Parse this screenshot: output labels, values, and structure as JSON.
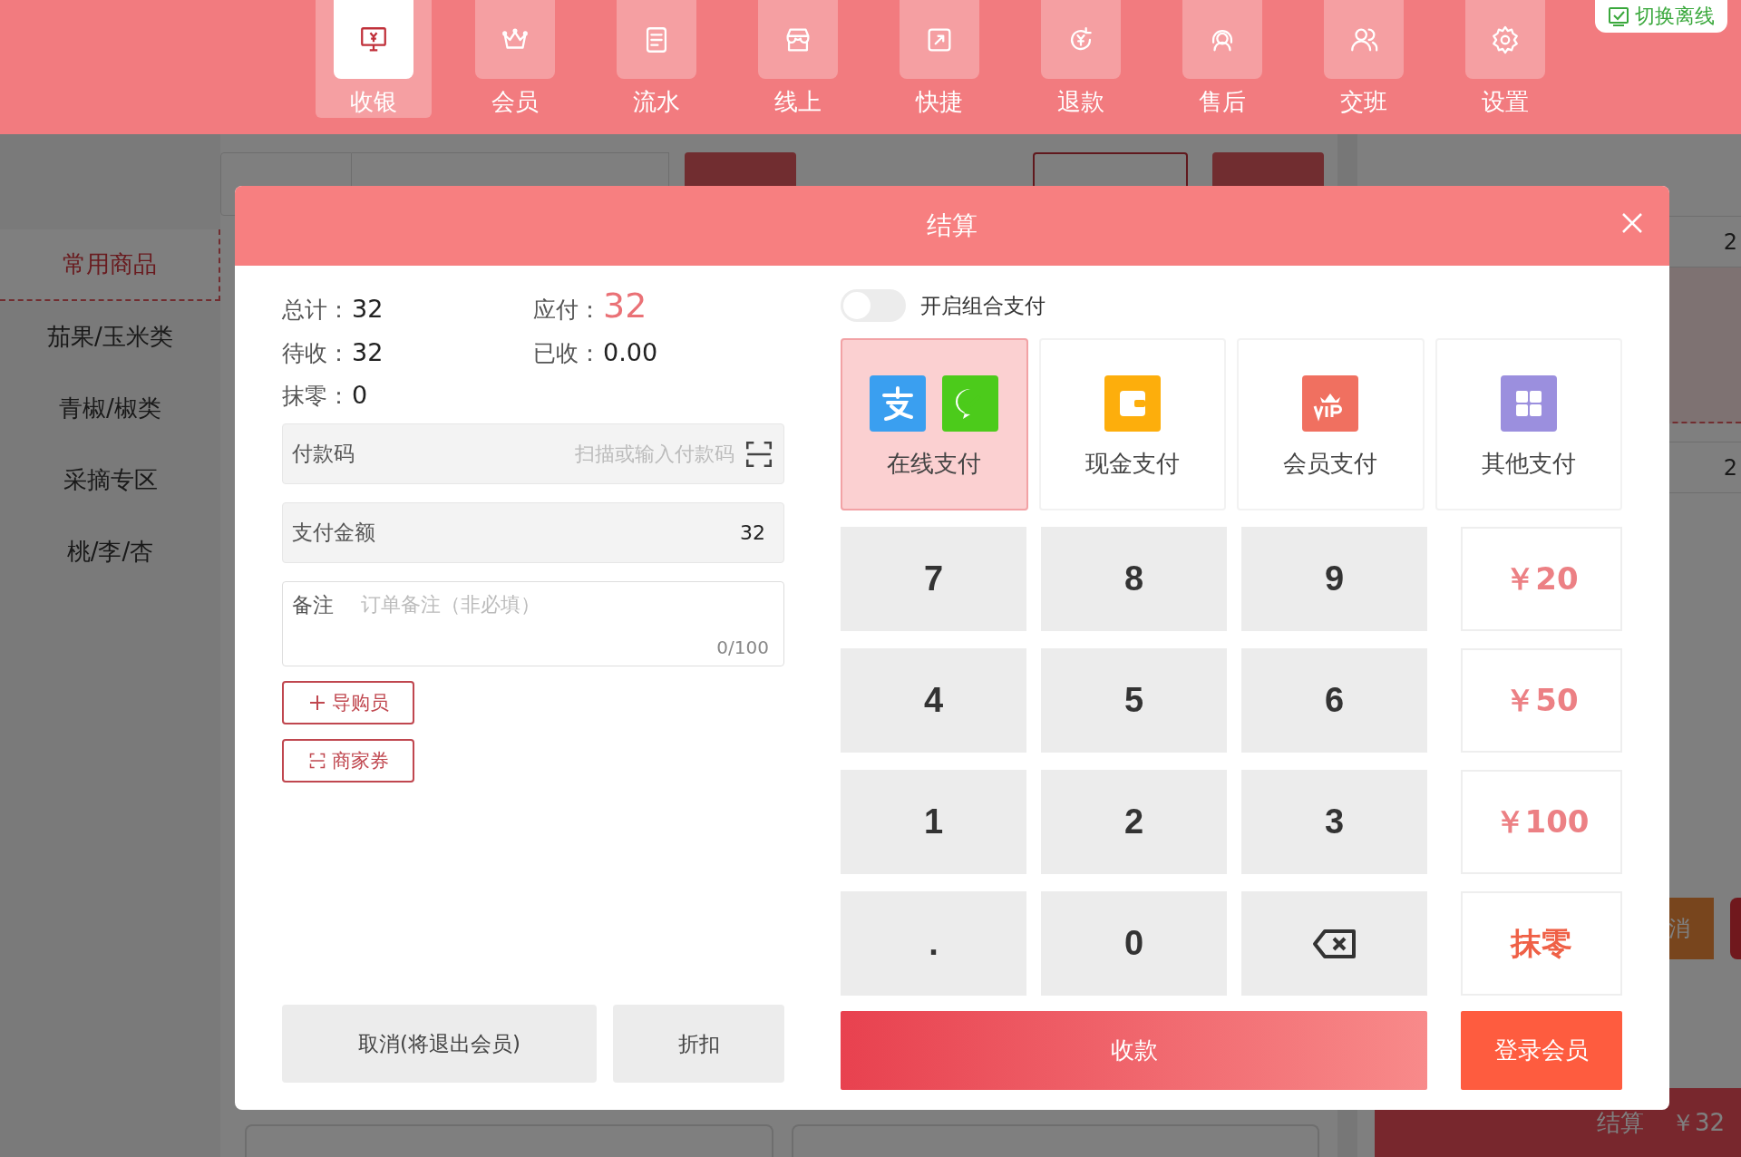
{
  "nav": {
    "items": [
      {
        "label": "收银",
        "kind": "register",
        "selected": true
      },
      {
        "label": "会员",
        "kind": "crown",
        "selected": false
      },
      {
        "label": "流水",
        "kind": "ledger",
        "selected": false
      },
      {
        "label": "线上",
        "kind": "store",
        "selected": false
      },
      {
        "label": "快捷",
        "kind": "shortcut",
        "selected": false
      },
      {
        "label": "退款",
        "kind": "refund",
        "selected": false
      },
      {
        "label": "售后",
        "kind": "service",
        "selected": false
      },
      {
        "label": "交班",
        "kind": "staff",
        "selected": false
      },
      {
        "label": "设置",
        "kind": "settings",
        "selected": false
      }
    ],
    "offline_button": "切换离线"
  },
  "sidebar": {
    "items": [
      {
        "label": "常用商品",
        "selected": true
      },
      {
        "label": "茄果/玉米类",
        "selected": false
      },
      {
        "label": "青椒/椒类",
        "selected": false
      },
      {
        "label": "采摘专区",
        "selected": false
      },
      {
        "label": "桃/李/杏",
        "selected": false
      }
    ]
  },
  "cart": {
    "rows": [
      {
        "value": "2"
      },
      {
        "value": "2"
      }
    ],
    "cancel_button": "消",
    "checkout": {
      "label": "结算",
      "amount": "￥32"
    }
  },
  "dialog": {
    "title": "结算",
    "summary": [
      {
        "label": "总计：",
        "value": "32",
        "kind": "plain"
      },
      {
        "label": "应付：",
        "value": "32",
        "kind": "highlight"
      },
      {
        "label": "待收：",
        "value": "32",
        "kind": "plain"
      },
      {
        "label": "已收：",
        "value": "0.00",
        "kind": "plain"
      },
      {
        "label": "抹零：",
        "value": "0",
        "kind": "plain"
      }
    ],
    "payment_code": {
      "label": "付款码",
      "placeholder": "扫描或输入付款码"
    },
    "amount": {
      "label": "支付金额",
      "value": "32"
    },
    "remark": {
      "label": "备注",
      "placeholder": "订单备注（非必填）",
      "counter": "0/100"
    },
    "extra_buttons": [
      {
        "label": "导购员",
        "kind": "plus"
      },
      {
        "label": "商家券",
        "kind": "scan"
      }
    ],
    "footer_buttons": [
      {
        "label": "取消(将退出会员)"
      },
      {
        "label": "折扣"
      }
    ],
    "combined_payment": {
      "label": "开启组合支付",
      "on": false
    },
    "methods": [
      {
        "label": "在线支付",
        "kind": "online",
        "selected": true
      },
      {
        "label": "现金支付",
        "kind": "cash",
        "selected": false
      },
      {
        "label": "会员支付",
        "kind": "vip",
        "selected": false
      },
      {
        "label": "其他支付",
        "kind": "other",
        "selected": false
      }
    ],
    "keypad": [
      {
        "label": "7",
        "kind": "digit"
      },
      {
        "label": "8",
        "kind": "digit"
      },
      {
        "label": "9",
        "kind": "digit"
      },
      {
        "label": "￥20",
        "kind": "quick"
      },
      {
        "label": "4",
        "kind": "digit"
      },
      {
        "label": "5",
        "kind": "digit"
      },
      {
        "label": "6",
        "kind": "digit"
      },
      {
        "label": "￥50",
        "kind": "quick"
      },
      {
        "label": "1",
        "kind": "digit"
      },
      {
        "label": "2",
        "kind": "digit"
      },
      {
        "label": "3",
        "kind": "digit"
      },
      {
        "label": "￥100",
        "kind": "quick"
      },
      {
        "label": ".",
        "kind": "digit"
      },
      {
        "label": "0",
        "kind": "digit"
      },
      {
        "kind": "backspace"
      },
      {
        "label": "抹零",
        "kind": "round"
      }
    ],
    "collect_button": "收款",
    "member_button": "登录会员"
  }
}
